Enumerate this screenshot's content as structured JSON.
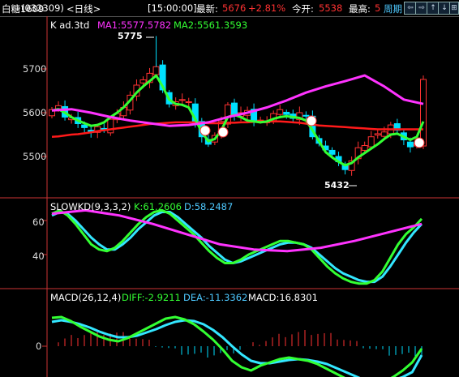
{
  "header": {
    "symbol": "白糖1609",
    "code": "(032309)",
    "period": "<日线>",
    "time": "[15:00:00]",
    "latest_label": "最新:",
    "latest_value": "5676",
    "change_pct": "+2.81%",
    "open_label": "今开:",
    "open_value": "5538",
    "high_label": "最高:",
    "high_value": "5",
    "cycle_label": "周期",
    "nav_buttons": [
      "⇦",
      "⇨",
      "↑",
      "↓",
      "⊞"
    ]
  },
  "kline": {
    "title": "K ad.3td",
    "ma1": "MA1:5577.5782",
    "ma2": "MA2:5561.3593",
    "yticks": [
      "5700",
      "5600",
      "5500"
    ],
    "high_mark": "5775",
    "low_mark": "5432"
  },
  "slowkd": {
    "title": "SLOWKD(9,3,3,2)",
    "k": "K:61.2606",
    "d": "D:58.2487",
    "yticks": [
      "60",
      "40"
    ]
  },
  "macd": {
    "title": "MACD(26,12,4)",
    "diff": "DIFF:-2.9211",
    "dea": "DEA:-11.3362",
    "macd": "MACD:16.8301",
    "yticks": [
      "0"
    ]
  },
  "colors": {
    "up": "#ff3232",
    "down": "#00e0ff",
    "ma1": "#ff33ff",
    "ma2": "#33ff33",
    "red_line": "#ff1a1a"
  },
  "chart_data": {
    "type": "candlestick",
    "close": [
      5607,
      5616,
      5590,
      5588,
      5575,
      5566,
      5555,
      5568,
      5560,
      5585,
      5598,
      5612,
      5640,
      5663,
      5675,
      5690,
      5705,
      5652,
      5620,
      5625,
      5630,
      5625,
      5578,
      5545,
      5528,
      5548,
      5580,
      5618,
      5592,
      5600,
      5605,
      5582,
      5583,
      5580,
      5598,
      5607,
      5596,
      5587,
      5600,
      5592,
      5545,
      5530,
      5515,
      5505,
      5488,
      5470,
      5490,
      5520,
      5525,
      5545,
      5552,
      5556,
      5572,
      5560,
      5538,
      5522,
      5530,
      5676
    ],
    "ma1": [
      5605,
      5608,
      5600,
      5590,
      5582,
      5576,
      5570,
      5572,
      5578,
      5590,
      5600,
      5612,
      5628,
      5646,
      5660,
      5672,
      5685,
      5660,
      5630,
      5620,
      5618,
      5612,
      5585,
      5556,
      5535,
      5540,
      5560,
      5590,
      5595,
      5590,
      5582,
      5580,
      5578,
      5580,
      5586,
      5590,
      5592,
      5590,
      5588,
      5582,
      5560,
      5535,
      5510,
      5498,
      5488,
      5480,
      5485,
      5498,
      5508,
      5518,
      5528,
      5540,
      5550,
      5552,
      5545,
      5538,
      5545,
      5580
    ],
    "ma2": [
      5545,
      5546,
      5548,
      5550,
      5551,
      5553,
      5555,
      5558,
      5560,
      5562,
      5564,
      5566,
      5568,
      5570,
      5572,
      5574,
      5575,
      5576,
      5577,
      5578,
      5578,
      5578,
      5578,
      5577,
      5576,
      5576,
      5576,
      5577,
      5577,
      5578,
      5578,
      5579,
      5580,
      5580,
      5580,
      5580,
      5579,
      5578,
      5577,
      5575,
      5573,
      5571,
      5570,
      5569,
      5568,
      5567,
      5566,
      5565,
      5564,
      5563,
      5562,
      5562,
      5562,
      5562,
      5562,
      5562,
      5562,
      5562
    ],
    "k": [
      64,
      66,
      63,
      58,
      52,
      46,
      43,
      42,
      44,
      48,
      53,
      58,
      62,
      65,
      66,
      64,
      60,
      56,
      52,
      47,
      42,
      38,
      35,
      35,
      37,
      40,
      42,
      44,
      46,
      48,
      48,
      47,
      46,
      43,
      38,
      33,
      29,
      26,
      24,
      23,
      23,
      25,
      30,
      38,
      46,
      52,
      56,
      61
    ],
    "d": [
      63,
      65,
      64,
      60,
      55,
      50,
      46,
      43,
      43,
      46,
      50,
      55,
      59,
      63,
      65,
      65,
      62,
      58,
      54,
      50,
      45,
      41,
      37,
      35,
      36,
      38,
      40,
      42,
      44,
      46,
      47,
      47,
      46,
      44,
      40,
      36,
      32,
      29,
      27,
      25,
      24,
      24,
      27,
      33,
      40,
      47,
      53,
      58
    ],
    "diff": [
      35,
      36,
      31,
      24,
      18,
      12,
      8,
      6,
      10,
      16,
      22,
      28,
      34,
      36,
      33,
      27,
      18,
      8,
      -4,
      -18,
      -26,
      -30,
      -24,
      -20,
      -16,
      -14,
      -16,
      -18,
      -22,
      -28,
      -34,
      -40,
      -46,
      -50,
      -48,
      -44,
      -38,
      -30,
      -20,
      -3
    ],
    "dea": [
      30,
      32,
      30,
      27,
      23,
      18,
      14,
      11,
      11,
      13,
      17,
      21,
      26,
      30,
      32,
      31,
      27,
      20,
      11,
      0,
      -10,
      -18,
      -21,
      -21,
      -19,
      -17,
      -16,
      -17,
      -19,
      -22,
      -27,
      -32,
      -37,
      -42,
      -44,
      -44,
      -42,
      -38,
      -32,
      -11
    ],
    "ylim": [
      5420,
      5800
    ]
  }
}
